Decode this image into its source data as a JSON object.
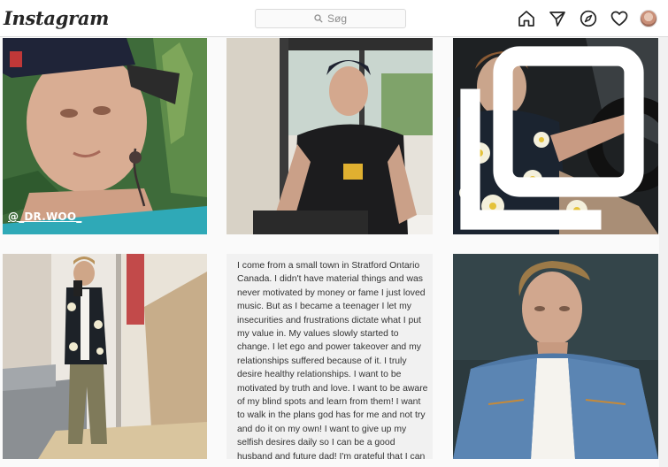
{
  "header": {
    "logo": "Instagram",
    "search_placeholder": "Søg",
    "icons": [
      "home-icon",
      "direct-message-icon",
      "explore-compass-icon",
      "activity-heart-icon"
    ]
  },
  "posts": [
    {
      "type": "photo",
      "tag": "@_DR.WOO_"
    },
    {
      "type": "photo"
    },
    {
      "type": "photo",
      "badge": "multi-photo-icon"
    },
    {
      "type": "photo"
    },
    {
      "type": "text",
      "caption": "I come from a small town in Stratford Ontario Canada. I didn't have material things and was never motivated by money or fame I just loved music. But as I became a teenager I let my insecurities and frustrations dictate what I put my value in. My values slowly started to change. I let ego and power takeover and my relationships suffered because of it.  I truly desire healthy relationships. I want to be motivated by truth and love. I want to be aware of my blind spots and learn from them! I want to walk in the plans god has for me and not try and do it on my own! I want to give up my selfish desires daily so I can be a good husband and future dad! I'm grateful that I can walk with Jesus as he leads the way."
    },
    {
      "type": "photo"
    }
  ],
  "colors": {
    "border": "#dbdbdb",
    "background": "#fafafa",
    "text": "#262626",
    "muted": "#8e8e8e"
  }
}
